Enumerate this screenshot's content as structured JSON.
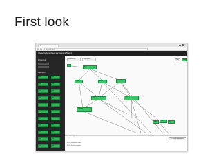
{
  "slide": {
    "title": "First look"
  },
  "browser": {
    "tab_title": "UI",
    "url": "localhost:3000",
    "app_title": "Interactive Experiment Management System"
  },
  "sidebar": {
    "section_properties": "Properties",
    "section_operators": "Operators",
    "items": [
      {
        "label": "op"
      },
      {
        "label": "op"
      },
      {
        "label": "op"
      },
      {
        "label": "op"
      },
      {
        "label": "op"
      },
      {
        "label": "op"
      },
      {
        "label": "op"
      },
      {
        "label": "op"
      },
      {
        "label": "op"
      },
      {
        "label": "op"
      },
      {
        "label": "op"
      },
      {
        "label": "op"
      },
      {
        "label": "op"
      },
      {
        "label": "op"
      },
      {
        "label": "op"
      },
      {
        "label": "op"
      },
      {
        "label": "op"
      },
      {
        "label": "op"
      },
      {
        "label": "op"
      },
      {
        "label": "op"
      },
      {
        "label": "op"
      },
      {
        "label": "op"
      }
    ]
  },
  "canvas": {
    "tabs": [
      {
        "label": "Experiment 1"
      },
      {
        "label": "Experiment 2"
      }
    ],
    "buttons": {
      "run": "Run",
      "save": "Save"
    },
    "nodes": [
      {
        "label": "Data Source"
      },
      {
        "label": "Split"
      },
      {
        "label": "Filter"
      },
      {
        "label": "Select"
      },
      {
        "label": "Join"
      },
      {
        "label": "Train"
      },
      {
        "label": "Score"
      },
      {
        "label": "Evaluate"
      },
      {
        "label": "Export"
      },
      {
        "label": "Result"
      },
      {
        "label": "Plot"
      }
    ]
  },
  "bottom": {
    "tabs": [
      "Log",
      "Output"
    ],
    "button": "Clear all experiments",
    "lines": [
      "INFO | Experiment loaded",
      "INFO | Running workflow ..."
    ]
  },
  "colors": {
    "node_green": "#3cc46a",
    "sidebar_bg": "#262626",
    "header_bg": "#1f1f1f"
  }
}
